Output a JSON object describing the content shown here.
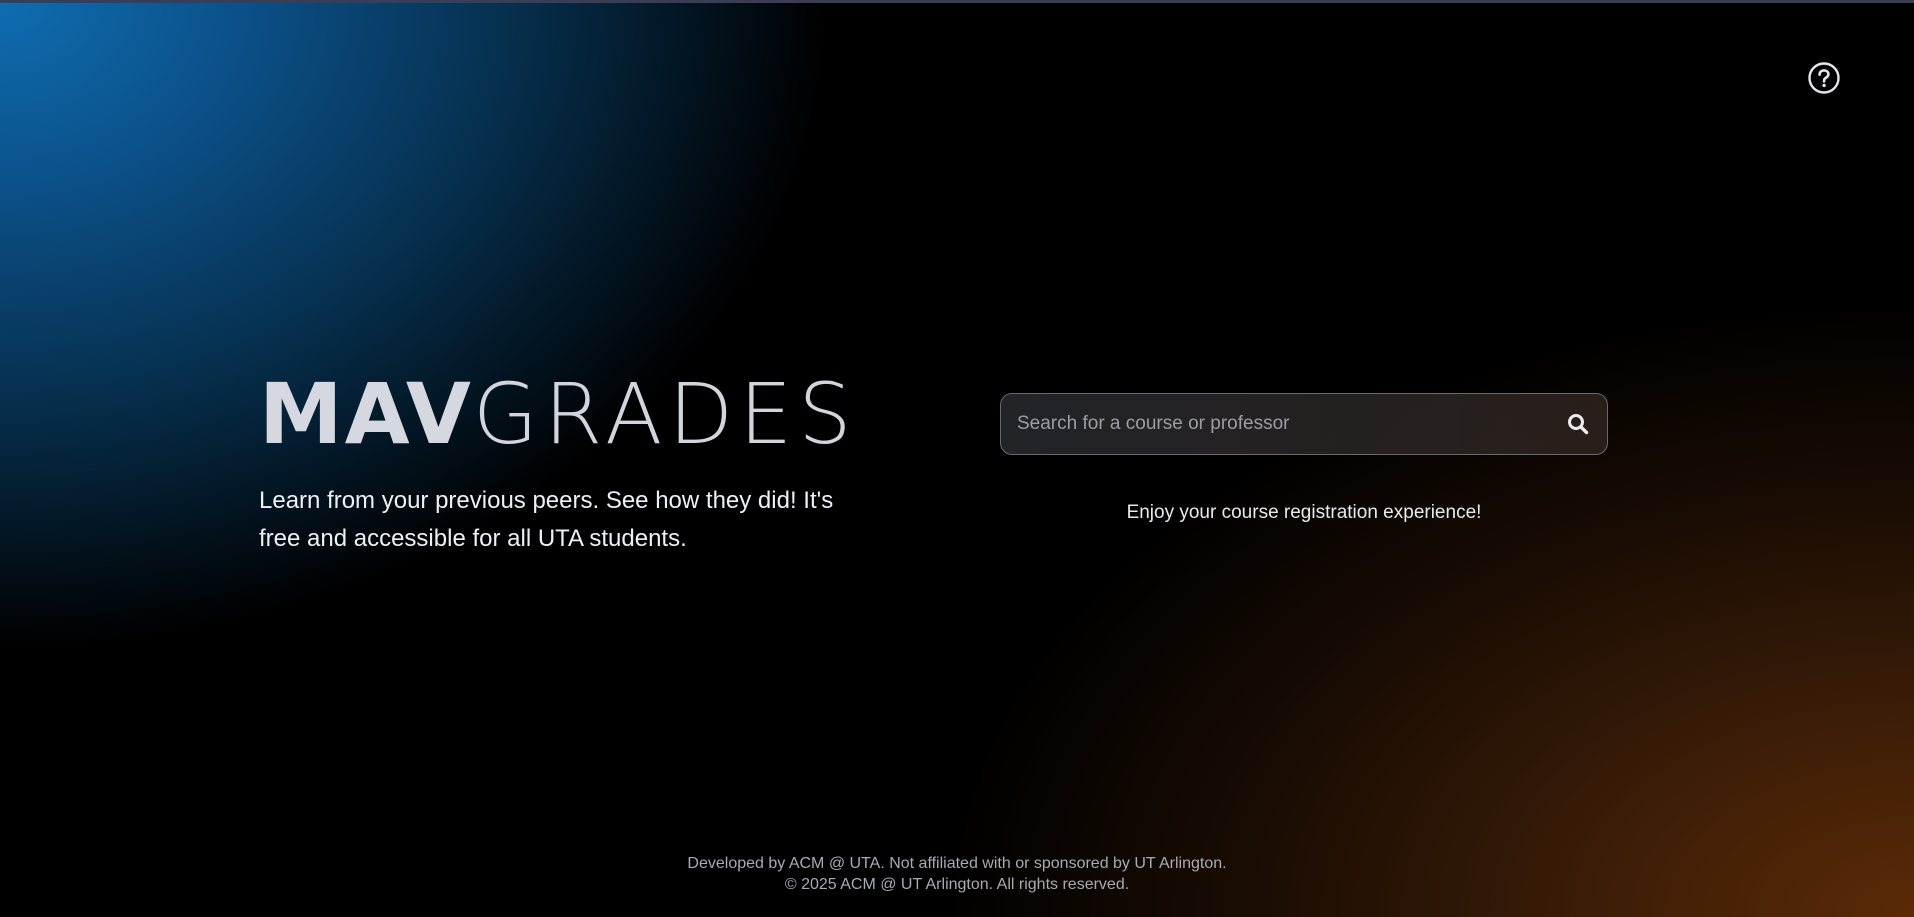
{
  "brand": {
    "part1": "MAV",
    "part2": "GRADES"
  },
  "hero": {
    "tagline": "Learn from your previous peers. See how they did! It's free and accessible for all UTA students."
  },
  "search": {
    "placeholder": "Search for a course or professor",
    "value": "",
    "icon": "search-icon"
  },
  "help": {
    "icon": "question-circle-icon"
  },
  "message": "Enjoy your course registration experience!",
  "footer": {
    "line1": "Developed by ACM @ UTA. Not affiliated with or sponsored by UT Arlington.",
    "line2": "© 2025 ACM @ UT Arlington. All rights reserved."
  },
  "colors": {
    "gradient_top_left": "#0f6db1",
    "gradient_bottom_right": "#5b2a06",
    "background": "#000000",
    "text": "#e8eaf0"
  }
}
